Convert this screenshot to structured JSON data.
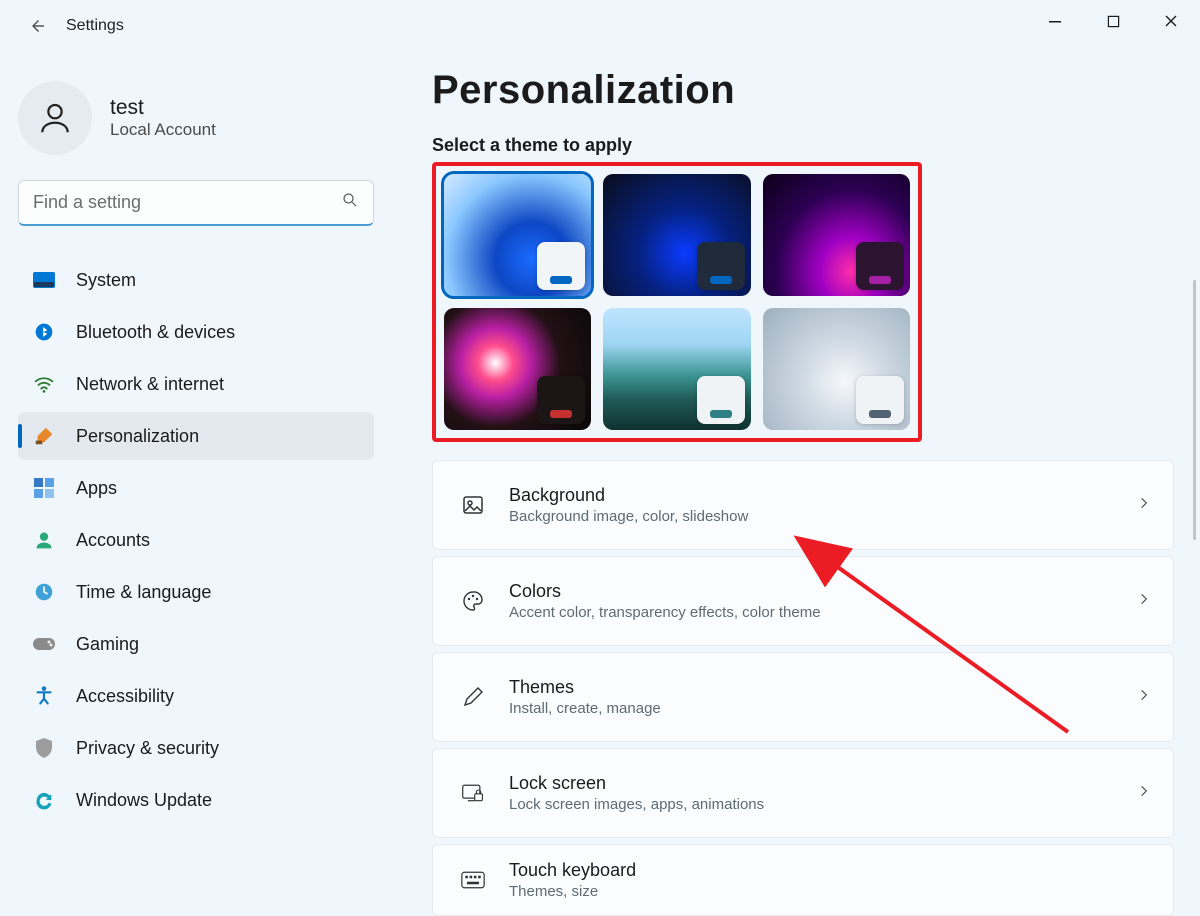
{
  "app": {
    "title": "Settings"
  },
  "user": {
    "name": "test",
    "sub": "Local Account"
  },
  "search": {
    "placeholder": "Find a setting"
  },
  "nav": {
    "items": [
      {
        "label": "System"
      },
      {
        "label": "Bluetooth & devices"
      },
      {
        "label": "Network & internet"
      },
      {
        "label": "Personalization"
      },
      {
        "label": "Apps"
      },
      {
        "label": "Accounts"
      },
      {
        "label": "Time & language"
      },
      {
        "label": "Gaming"
      },
      {
        "label": "Accessibility"
      },
      {
        "label": "Privacy & security"
      },
      {
        "label": "Windows Update"
      }
    ]
  },
  "page": {
    "title": "Personalization",
    "theme_header": "Select a theme to apply"
  },
  "options": [
    {
      "icon": "picture-icon",
      "title": "Background",
      "subtitle": "Background image, color, slideshow"
    },
    {
      "icon": "palette-icon",
      "title": "Colors",
      "subtitle": "Accent color, transparency effects, color theme"
    },
    {
      "icon": "pen-icon",
      "title": "Themes",
      "subtitle": "Install, create, manage"
    },
    {
      "icon": "lock-icon",
      "title": "Lock screen",
      "subtitle": "Lock screen images, apps, animations"
    },
    {
      "icon": "keyboard-icon",
      "title": "Touch keyboard",
      "subtitle": "Themes, size"
    }
  ]
}
